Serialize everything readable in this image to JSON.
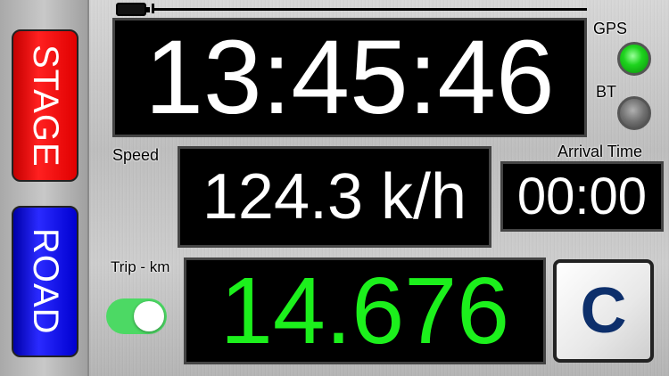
{
  "buttons": {
    "stage": "STAGE",
    "road": "ROAD",
    "clear": "C"
  },
  "clock": "13:45:46",
  "labels": {
    "gps": "GPS",
    "bt": "BT",
    "speed": "Speed",
    "arrival": "Arrival Time",
    "trip": "Trip - km"
  },
  "readouts": {
    "speed": "124.3 k/h",
    "arrival": "00:00",
    "trip": "14.676"
  },
  "status": {
    "gps_on": true,
    "bt_on": false,
    "trip_toggle_on": true
  },
  "colors": {
    "stage_red": "#ff2020",
    "road_blue": "#2a2aff",
    "trip_green": "#1cf01c",
    "gps_led": "#1ed41e",
    "bt_led": "#707070",
    "toggle_green": "#4cd964",
    "clear_text": "#0d2f6b"
  },
  "icons": {
    "battery": "battery-icon",
    "gps_led": "gps-indicator-icon",
    "bt_led": "bluetooth-indicator-icon"
  }
}
